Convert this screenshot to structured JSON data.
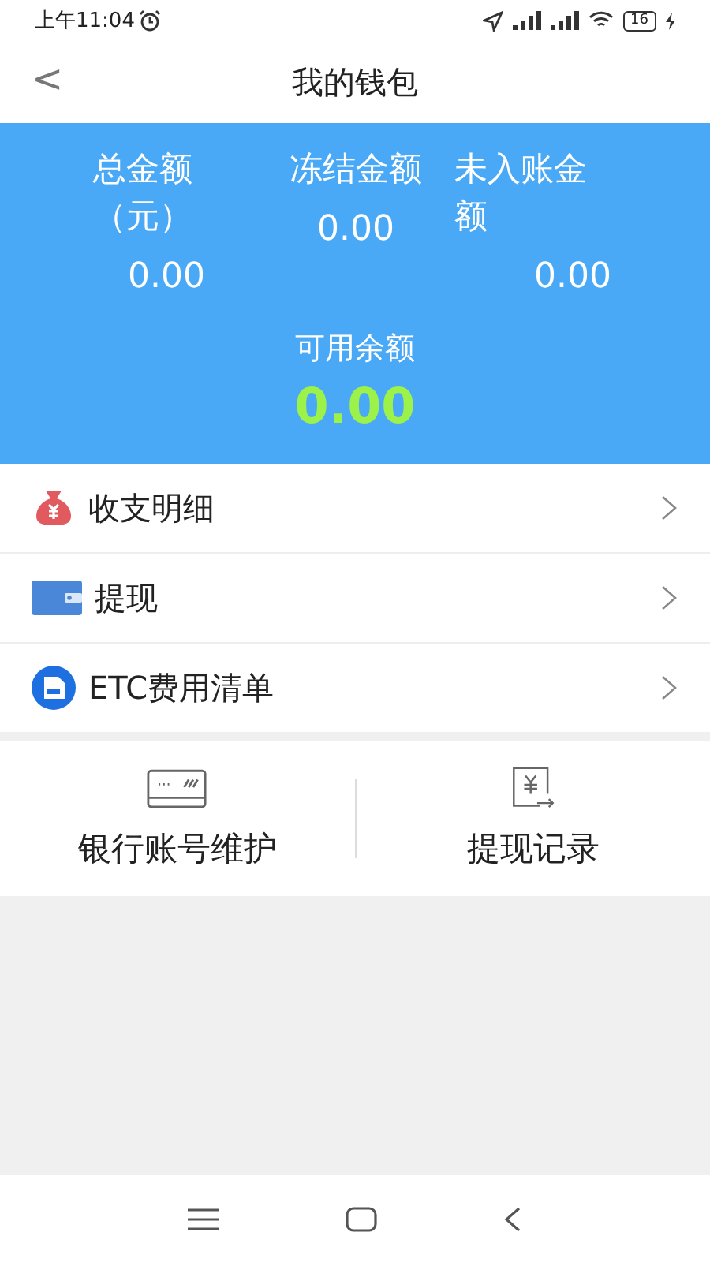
{
  "status_bar": {
    "time": "上午11:04",
    "battery": "16"
  },
  "header": {
    "back": "<",
    "title": "我的钱包"
  },
  "summary": {
    "columns": [
      {
        "label": "总金额（元）",
        "value": "0.00"
      },
      {
        "label": "冻结金额",
        "value": "0.00"
      },
      {
        "label": "未入账金额",
        "value": "0.00"
      }
    ],
    "available_label": "可用余额",
    "available_value": "0.00"
  },
  "menu": [
    {
      "kind": "moneybag",
      "label": "收支明细"
    },
    {
      "kind": "wallet",
      "label": "提现"
    },
    {
      "kind": "etc",
      "label": "ETC费用清单"
    }
  ],
  "shortcuts": [
    {
      "kind": "card",
      "label": "银行账号维护"
    },
    {
      "kind": "receipt",
      "label": "提现记录"
    }
  ]
}
